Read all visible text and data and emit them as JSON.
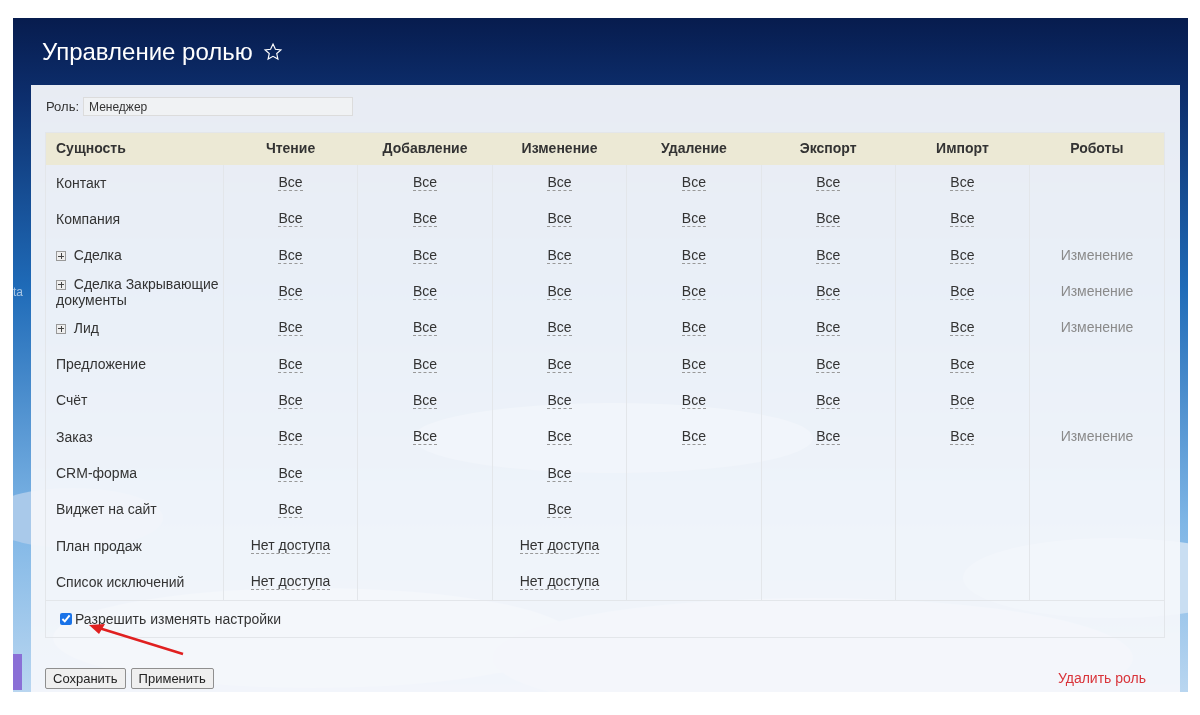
{
  "page": {
    "title": "Управление ролью",
    "favorite": false,
    "edge_text": "ta"
  },
  "role": {
    "label": "Роль:",
    "value": "Менеджер"
  },
  "table": {
    "columns": [
      "Сущность",
      "Чтение",
      "Добавление",
      "Изменение",
      "Удаление",
      "Экспорт",
      "Импорт",
      "Роботы"
    ],
    "rows": [
      {
        "expandable": false,
        "cells": [
          "Контакт",
          "Все",
          "Все",
          "Все",
          "Все",
          "Все",
          "Все",
          ""
        ]
      },
      {
        "expandable": false,
        "cells": [
          "Компания",
          "Все",
          "Все",
          "Все",
          "Все",
          "Все",
          "Все",
          ""
        ]
      },
      {
        "expandable": true,
        "cells": [
          "Сделка",
          "Все",
          "Все",
          "Все",
          "Все",
          "Все",
          "Все",
          "Изменение"
        ]
      },
      {
        "expandable": true,
        "cells": [
          "Сделка Закрывающие документы",
          "Все",
          "Все",
          "Все",
          "Все",
          "Все",
          "Все",
          "Изменение"
        ]
      },
      {
        "expandable": true,
        "cells": [
          "Лид",
          "Все",
          "Все",
          "Все",
          "Все",
          "Все",
          "Все",
          "Изменение"
        ]
      },
      {
        "expandable": false,
        "cells": [
          "Предложение",
          "Все",
          "Все",
          "Все",
          "Все",
          "Все",
          "Все",
          ""
        ]
      },
      {
        "expandable": false,
        "cells": [
          "Счёт",
          "Все",
          "Все",
          "Все",
          "Все",
          "Все",
          "Все",
          ""
        ]
      },
      {
        "expandable": false,
        "cells": [
          "Заказ",
          "Все",
          "Все",
          "Все",
          "Все",
          "Все",
          "Все",
          "Изменение"
        ]
      },
      {
        "expandable": false,
        "cells": [
          "CRM-форма",
          "Все",
          "",
          "Все",
          "",
          "",
          "",
          ""
        ]
      },
      {
        "expandable": false,
        "cells": [
          "Виджет на сайт",
          "Все",
          "",
          "Все",
          "",
          "",
          "",
          ""
        ]
      },
      {
        "expandable": false,
        "cells": [
          "План продаж",
          "Нет доступа",
          "",
          "Нет доступа",
          "",
          "",
          "",
          ""
        ]
      },
      {
        "expandable": false,
        "cells": [
          "Список исключений",
          "Нет доступа",
          "",
          "Нет доступа",
          "",
          "",
          "",
          ""
        ]
      }
    ]
  },
  "allow_settings": {
    "label": "Разрешить изменять настройки",
    "checked": true
  },
  "buttons": [
    "Сохранить",
    "Применить"
  ],
  "delete_link": "Удалить роль"
}
